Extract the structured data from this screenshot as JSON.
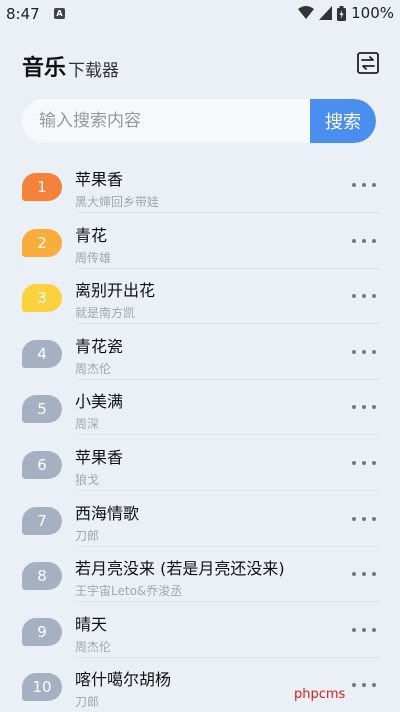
{
  "status_bar": {
    "time": "8:47",
    "notification_icon": "a-notification-icon",
    "battery_percent": "100%"
  },
  "header": {
    "title": "音乐",
    "subtitle": "下载器",
    "switch_icon": "swap-icon"
  },
  "search": {
    "placeholder": "输入搜索内容",
    "value": "",
    "button_label": "搜索",
    "button_color": "#4a8ef0"
  },
  "colors": {
    "rank_top1": "#f5813a",
    "rank_top2": "#f9ad3b",
    "rank_top3": "#fbd23d",
    "rank_other": "#a5b1c2"
  },
  "songs": [
    {
      "rank": "1",
      "title": "苹果香",
      "artist": "黑大婶回乡带娃"
    },
    {
      "rank": "2",
      "title": "青花",
      "artist": "周传雄"
    },
    {
      "rank": "3",
      "title": "离别开出花",
      "artist": "就是南方凯"
    },
    {
      "rank": "4",
      "title": "青花瓷",
      "artist": "周杰伦"
    },
    {
      "rank": "5",
      "title": "小美满",
      "artist": "周深"
    },
    {
      "rank": "6",
      "title": "苹果香",
      "artist": "狼戈"
    },
    {
      "rank": "7",
      "title": "西海情歌",
      "artist": "刀郎"
    },
    {
      "rank": "8",
      "title": "若月亮没来 (若是月亮还没来)",
      "artist": "王宇宙Leto&乔浚丞"
    },
    {
      "rank": "9",
      "title": "晴天",
      "artist": "周杰伦"
    },
    {
      "rank": "10",
      "title": "喀什噶尔胡杨",
      "artist": "刀郎"
    }
  ],
  "watermark": "phpcms"
}
